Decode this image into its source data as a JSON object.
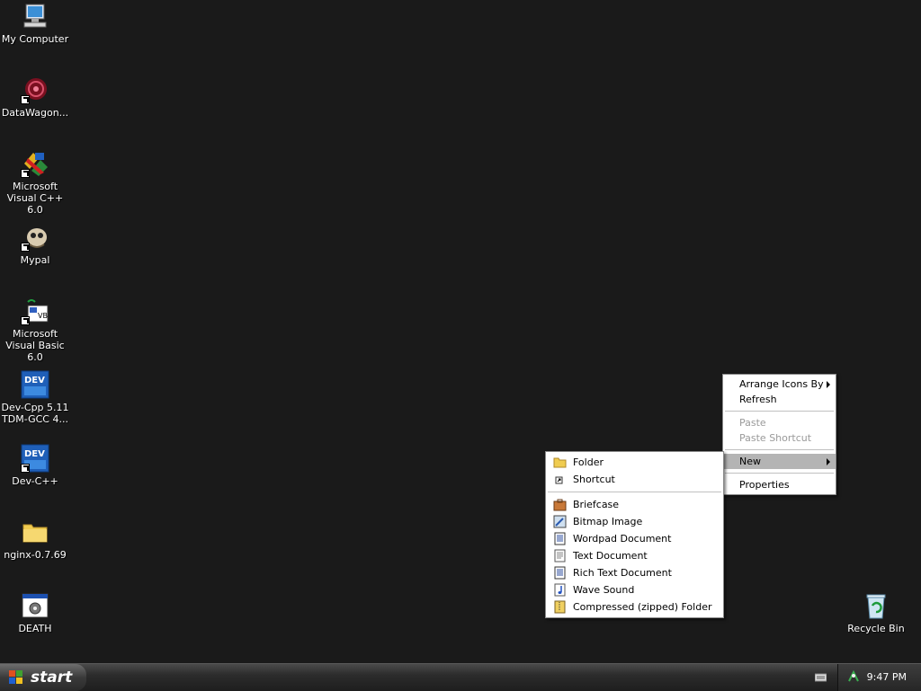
{
  "desktop_icons": [
    {
      "name": "icon-my-computer",
      "label": "My Computer"
    },
    {
      "name": "icon-datawagon",
      "label": "DataWagon..."
    },
    {
      "name": "icon-msvc",
      "label": "Microsoft Visual C++ 6.0"
    },
    {
      "name": "icon-mypal",
      "label": "Mypal"
    },
    {
      "name": "icon-msvb",
      "label": "Microsoft Visual Basic 6.0"
    },
    {
      "name": "icon-devcpp-tdm",
      "label": "Dev-Cpp 5.11 TDM-GCC 4..."
    },
    {
      "name": "icon-devcpp",
      "label": "Dev-C++"
    },
    {
      "name": "icon-nginx",
      "label": "nginx-0.7.69"
    },
    {
      "name": "icon-death",
      "label": "DEATH"
    },
    {
      "name": "icon-recycle-bin",
      "label": "Recycle Bin"
    }
  ],
  "context_menu": {
    "arrange": "Arrange Icons By",
    "refresh": "Refresh",
    "paste": "Paste",
    "paste_shortcut": "Paste Shortcut",
    "new": "New",
    "properties": "Properties"
  },
  "new_menu": {
    "folder": "Folder",
    "shortcut": "Shortcut",
    "briefcase": "Briefcase",
    "bitmap": "Bitmap Image",
    "wordpad": "Wordpad Document",
    "text": "Text Document",
    "rtf": "Rich Text Document",
    "wave": "Wave Sound",
    "zip": "Compressed (zipped) Folder"
  },
  "taskbar": {
    "start_label": "start",
    "clock": "9:47 PM"
  }
}
